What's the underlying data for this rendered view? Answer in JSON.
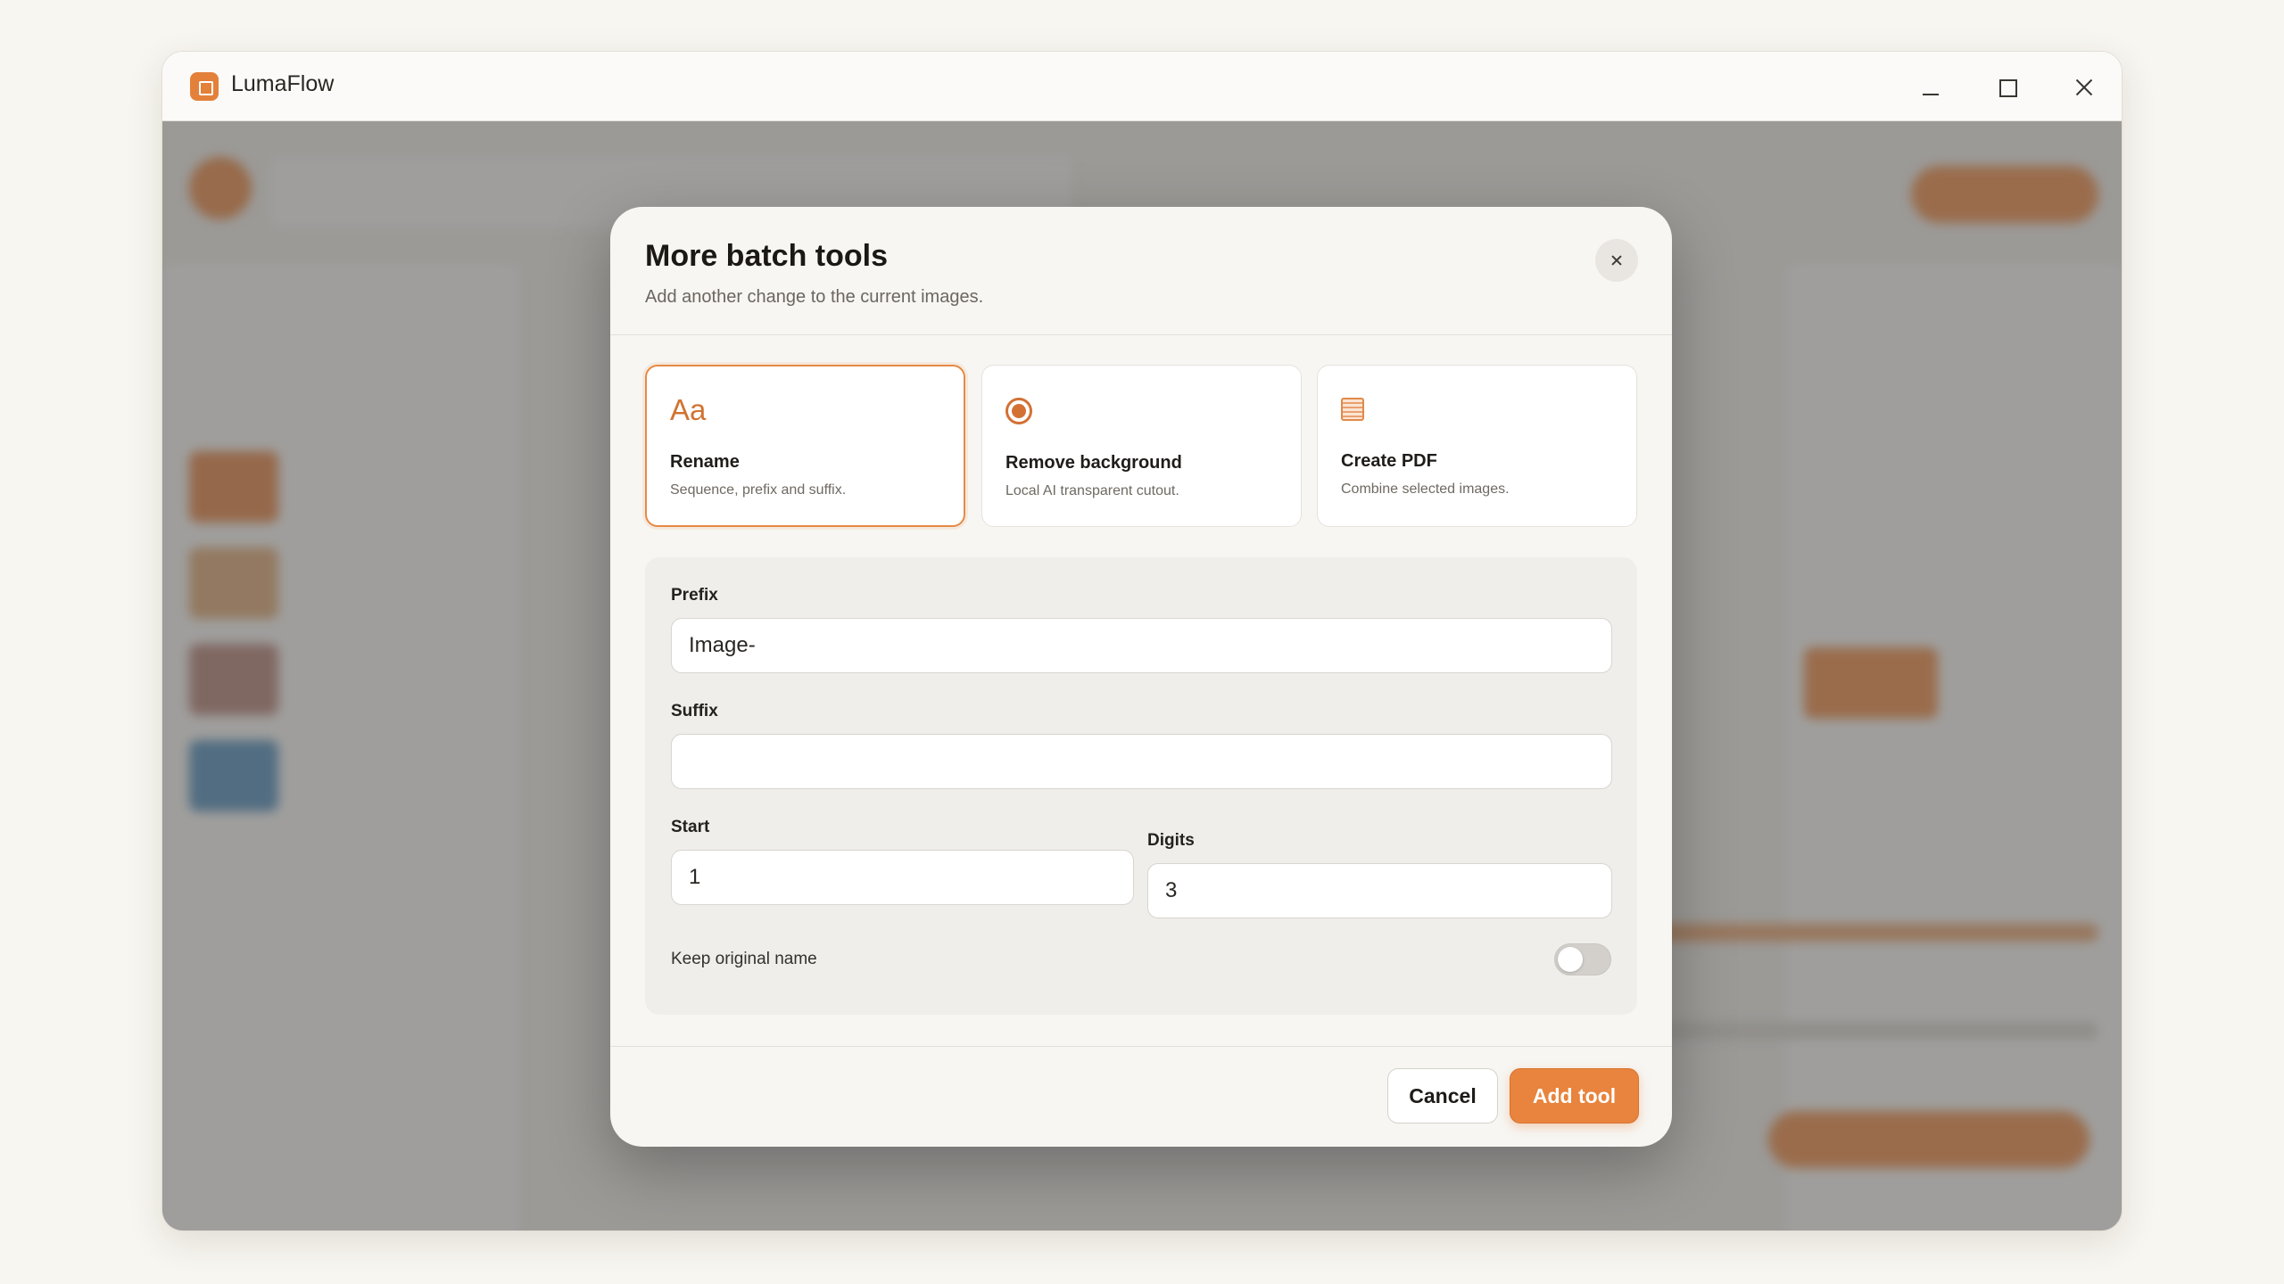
{
  "window": {
    "title": "LumaFlow"
  },
  "modal": {
    "title": "More batch tools",
    "subtitle": "Add another change to the current images.",
    "tools": [
      {
        "name": "Rename",
        "description": "Sequence, prefix and suffix.",
        "icon": "Aa",
        "selected": true
      },
      {
        "name": "Remove background",
        "description": "Local AI transparent cutout.",
        "icon": "target-icon",
        "selected": false
      },
      {
        "name": "Create PDF",
        "description": "Combine selected images.",
        "icon": "document-icon",
        "selected": false
      }
    ],
    "fields": {
      "prefix": {
        "label": "Prefix",
        "value": "Image-"
      },
      "suffix": {
        "label": "Suffix",
        "value": ""
      },
      "start": {
        "label": "Start",
        "value": "1"
      },
      "digits": {
        "label": "Digits",
        "value": "3"
      }
    },
    "keep_original": {
      "label": "Keep original name",
      "enabled": false
    },
    "cancel_label": "Cancel",
    "add_label": "Add tool"
  },
  "colors": {
    "accent": "#e8843d",
    "accent_dark": "#d37134"
  }
}
